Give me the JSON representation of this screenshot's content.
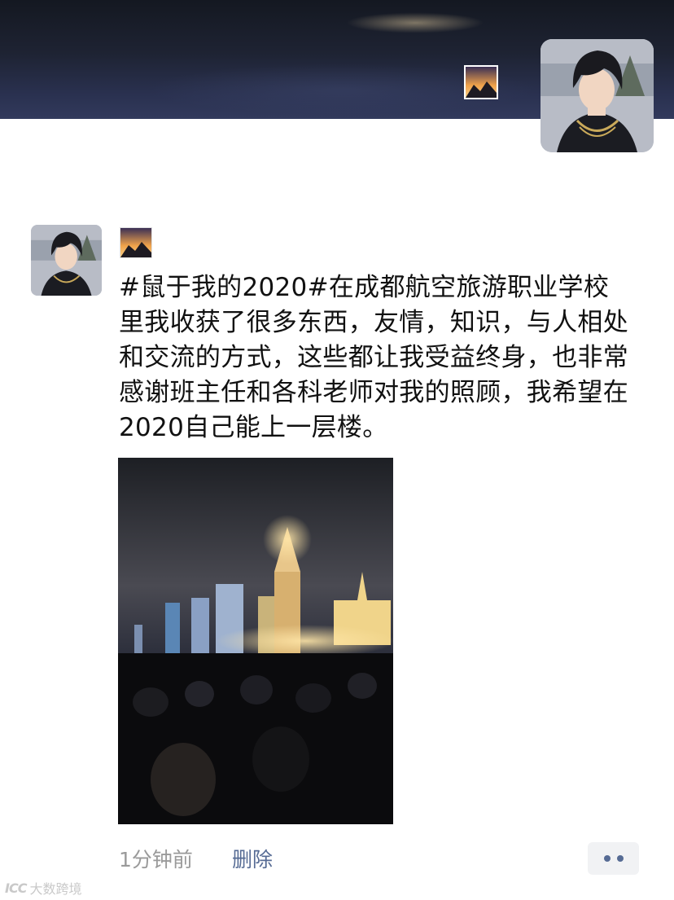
{
  "cover": {
    "icon": "landscape-photo-icon"
  },
  "profile": {
    "avatar_icon": "anime-character-avatar"
  },
  "post": {
    "avatar_icon": "anime-character-avatar",
    "thumb_icon": "landscape-photo-icon",
    "text": "#鼠于我的2020#在成都航空旅游职业学校里我收获了很多东西，友情，知识，与人相处和交流的方式，这些都让我受益终身，也非常感谢班主任和各科老师对我的照顾，我希望在2020自己能上一层楼。",
    "photo_icon": "night-city-crowd-photo",
    "time": "1分钟前",
    "delete_label": "删除",
    "more_icon": "more-dots-icon"
  },
  "watermark": {
    "logo": "ICC",
    "text": "大数跨境"
  }
}
